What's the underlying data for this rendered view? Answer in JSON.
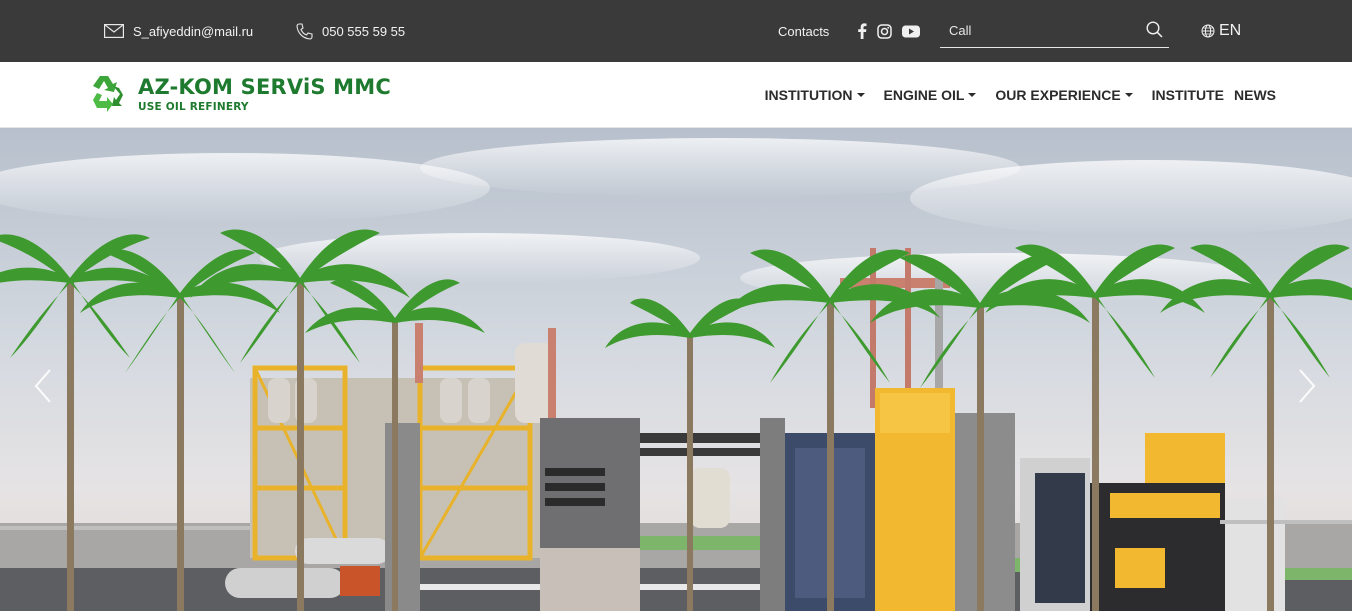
{
  "topbar": {
    "email": "S_afiyeddin@mail.ru",
    "phone": "050 555 59 55",
    "contacts_label": "Contacts",
    "social_icons": [
      "facebook-icon",
      "instagram-icon",
      "youtube-icon"
    ],
    "search": {
      "placeholder": "Call",
      "value": ""
    },
    "language": "EN"
  },
  "header": {
    "logo": {
      "title": "AZ-KOM SERViS MMC",
      "subtitle": "USE OIL REFINERY",
      "color": "#1e7a2f"
    },
    "nav": [
      {
        "label": "INSTITUTION",
        "dropdown": true
      },
      {
        "label": "ENGINE OIL",
        "dropdown": true
      },
      {
        "label": "OUR EXPERIENCE",
        "dropdown": true
      },
      {
        "label": "INSTITUTE",
        "dropdown": false
      },
      {
        "label": "NEWS",
        "dropdown": false
      }
    ]
  },
  "hero": {
    "slider_controls": [
      "chevron-left-icon",
      "chevron-right-icon"
    ]
  },
  "colors": {
    "topbar_bg": "#3a3a3a",
    "brand_green": "#1e7a2f",
    "building_yellow": "#f2b830"
  }
}
